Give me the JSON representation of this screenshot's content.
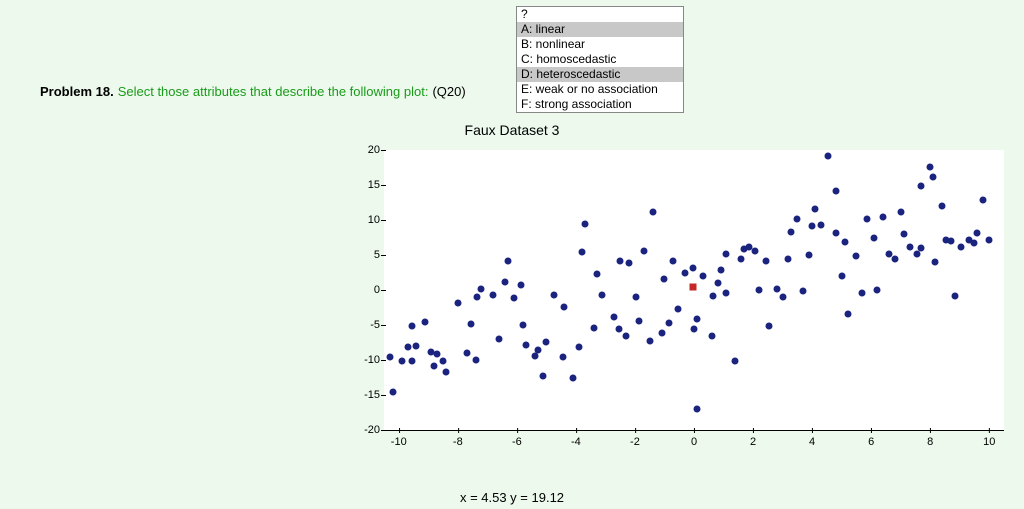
{
  "problem": {
    "label": "Problem 18.",
    "text": "Select those attributes that describe the following plot:",
    "qref": "(Q20)"
  },
  "select": {
    "placeholder": "?",
    "options": [
      {
        "label": "A: linear",
        "selected": true
      },
      {
        "label": "B: nonlinear",
        "selected": false
      },
      {
        "label": "C: homoscedastic",
        "selected": false
      },
      {
        "label": "D: heteroscedastic",
        "selected": true
      },
      {
        "label": "E: weak or no association",
        "selected": false
      },
      {
        "label": "F: strong association",
        "selected": false
      }
    ]
  },
  "readout": "x = 4.53 y = 19.12",
  "chart_data": {
    "type": "scatter",
    "title": "Faux Dataset 3",
    "xlabel": "",
    "ylabel": "",
    "xlim": [
      -10.5,
      10.5
    ],
    "ylim": [
      -20,
      20
    ],
    "xticks": [
      -10,
      -8,
      -6,
      -4,
      -2,
      0,
      2,
      4,
      6,
      8,
      10
    ],
    "yticks": [
      -20,
      -15,
      -10,
      -5,
      0,
      5,
      10,
      15,
      20
    ],
    "marker": {
      "x": -0.05,
      "y": 0.5
    },
    "series": [
      {
        "name": "points",
        "points": [
          [
            -10.3,
            -9.5
          ],
          [
            -10.2,
            -14.5
          ],
          [
            -9.9,
            -10.2
          ],
          [
            -9.7,
            -8.1
          ],
          [
            -9.55,
            -10.1
          ],
          [
            -9.55,
            -5.1
          ],
          [
            -9.4,
            -8.0
          ],
          [
            -9.1,
            -4.6
          ],
          [
            -8.9,
            -8.8
          ],
          [
            -8.8,
            -10.9
          ],
          [
            -8.7,
            -9.1
          ],
          [
            -8.5,
            -10.2
          ],
          [
            -8.4,
            -11.7
          ],
          [
            -8.0,
            -1.9
          ],
          [
            -7.7,
            -9.0
          ],
          [
            -7.55,
            -4.8
          ],
          [
            -7.35,
            -1.0
          ],
          [
            -7.4,
            -10.0
          ],
          [
            -7.2,
            0.2
          ],
          [
            -6.8,
            -0.7
          ],
          [
            -6.6,
            -7.0
          ],
          [
            -6.4,
            1.2
          ],
          [
            -6.3,
            4.2
          ],
          [
            -6.1,
            -1.1
          ],
          [
            -5.85,
            0.7
          ],
          [
            -5.8,
            -5.0
          ],
          [
            -5.7,
            -7.9
          ],
          [
            -5.4,
            -9.4
          ],
          [
            -5.3,
            -8.6
          ],
          [
            -5.1,
            -12.3
          ],
          [
            -5.0,
            -7.4
          ],
          [
            -4.75,
            -0.7
          ],
          [
            -4.45,
            -9.6
          ],
          [
            -4.4,
            -2.4
          ],
          [
            -4.1,
            -12.5
          ],
          [
            -3.9,
            -8.2
          ],
          [
            -3.8,
            5.4
          ],
          [
            -3.7,
            9.5
          ],
          [
            -3.4,
            -5.4
          ],
          [
            -3.1,
            -0.7
          ],
          [
            -3.3,
            2.3
          ],
          [
            -2.7,
            -3.8
          ],
          [
            -2.55,
            -5.6
          ],
          [
            -2.5,
            4.2
          ],
          [
            -2.3,
            -6.5
          ],
          [
            -2.2,
            3.9
          ],
          [
            -1.95,
            -1.0
          ],
          [
            -1.85,
            -4.4
          ],
          [
            -1.7,
            5.6
          ],
          [
            -1.5,
            -7.3
          ],
          [
            -1.4,
            11.1
          ],
          [
            -1.1,
            -6.1
          ],
          [
            -1.0,
            1.6
          ],
          [
            -0.85,
            -4.7
          ],
          [
            -0.7,
            4.1
          ],
          [
            -0.55,
            -2.7
          ],
          [
            -0.3,
            2.4
          ],
          [
            -0.05,
            3.2
          ],
          [
            0.0,
            -5.6
          ],
          [
            0.1,
            -17.0
          ],
          [
            0.1,
            -4.2
          ],
          [
            0.3,
            2.0
          ],
          [
            0.6,
            -6.5
          ],
          [
            0.65,
            -0.9
          ],
          [
            0.8,
            1.0
          ],
          [
            0.9,
            2.8
          ],
          [
            1.1,
            5.1
          ],
          [
            1.1,
            -0.4
          ],
          [
            1.4,
            -10.1
          ],
          [
            1.6,
            4.4
          ],
          [
            1.7,
            5.8
          ],
          [
            1.85,
            6.2
          ],
          [
            2.05,
            5.6
          ],
          [
            2.2,
            0.0
          ],
          [
            2.45,
            4.1
          ],
          [
            2.55,
            -5.1
          ],
          [
            2.8,
            0.1
          ],
          [
            3.0,
            -1.0
          ],
          [
            3.2,
            4.5
          ],
          [
            3.3,
            8.3
          ],
          [
            3.5,
            10.2
          ],
          [
            3.7,
            -0.2
          ],
          [
            3.9,
            5.0
          ],
          [
            4.0,
            9.2
          ],
          [
            4.1,
            11.6
          ],
          [
            4.3,
            9.3
          ],
          [
            4.55,
            19.1
          ],
          [
            4.8,
            8.1
          ],
          [
            4.8,
            14.1
          ],
          [
            5.0,
            2.0
          ],
          [
            5.1,
            6.8
          ],
          [
            5.2,
            -3.4
          ],
          [
            5.5,
            4.8
          ],
          [
            5.7,
            -0.4
          ],
          [
            5.85,
            10.2
          ],
          [
            6.1,
            7.4
          ],
          [
            6.2,
            0.0
          ],
          [
            6.4,
            10.5
          ],
          [
            6.6,
            5.2
          ],
          [
            6.8,
            4.4
          ],
          [
            7.0,
            11.2
          ],
          [
            7.1,
            8.0
          ],
          [
            7.3,
            6.1
          ],
          [
            7.55,
            5.1
          ],
          [
            7.7,
            6.0
          ],
          [
            7.7,
            14.9
          ],
          [
            8.0,
            17.6
          ],
          [
            8.1,
            16.2
          ],
          [
            8.15,
            4.0
          ],
          [
            8.4,
            12.0
          ],
          [
            8.55,
            7.2
          ],
          [
            8.7,
            7.0
          ],
          [
            8.85,
            -0.9
          ],
          [
            9.05,
            6.1
          ],
          [
            9.3,
            7.2
          ],
          [
            9.5,
            6.7
          ],
          [
            9.6,
            8.2
          ],
          [
            9.8,
            12.9
          ],
          [
            10.0,
            7.1
          ]
        ]
      }
    ]
  }
}
